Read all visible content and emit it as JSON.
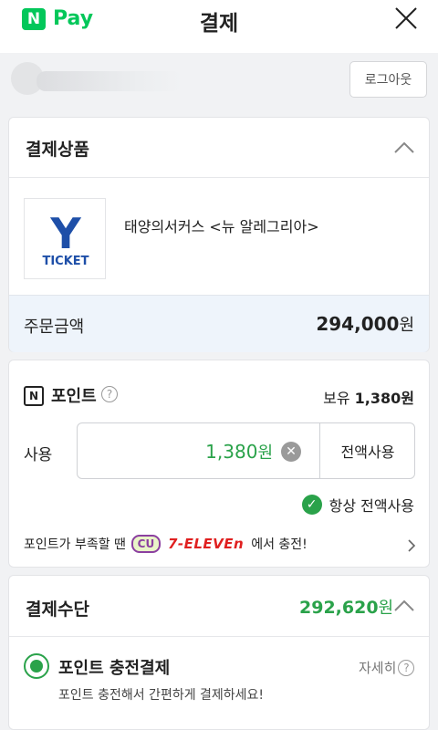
{
  "header": {
    "logo_letter": "N",
    "logo_text": "Pay",
    "title": "결제"
  },
  "account": {
    "logout_label": "로그아웃"
  },
  "product_section": {
    "title": "결제상품",
    "product_name": "태양의서커스 <뉴 알레그리아>",
    "product_logo": {
      "letter": "Y",
      "word": "TICKET"
    },
    "order_label": "주문금액",
    "order_amount": "294,000",
    "currency": "원"
  },
  "points_section": {
    "icon_letter": "N",
    "title": "포인트",
    "help": "?",
    "hold_label": "보유",
    "hold_amount": "1,380원",
    "use_label": "사용",
    "use_value": "1,380",
    "currency": "원",
    "use_all_label": "전액사용",
    "always_label": "항상 전액사용",
    "promo_prefix": "포인트가 부족할 땐",
    "cu_label": "CU",
    "seven_label": "7-ELEVEn",
    "promo_suffix": "에서 충전!"
  },
  "payment_section": {
    "title": "결제수단",
    "amount": "292,620",
    "currency": "원",
    "method_name": "포인트 충전결제",
    "detail_label": "자세히",
    "method_desc": "포인트 충전해서 간편하게 결제하세요!"
  },
  "colors": {
    "brand_green": "#03c75a",
    "amount_green": "#2aa24a",
    "order_bg": "#eef4fb"
  }
}
